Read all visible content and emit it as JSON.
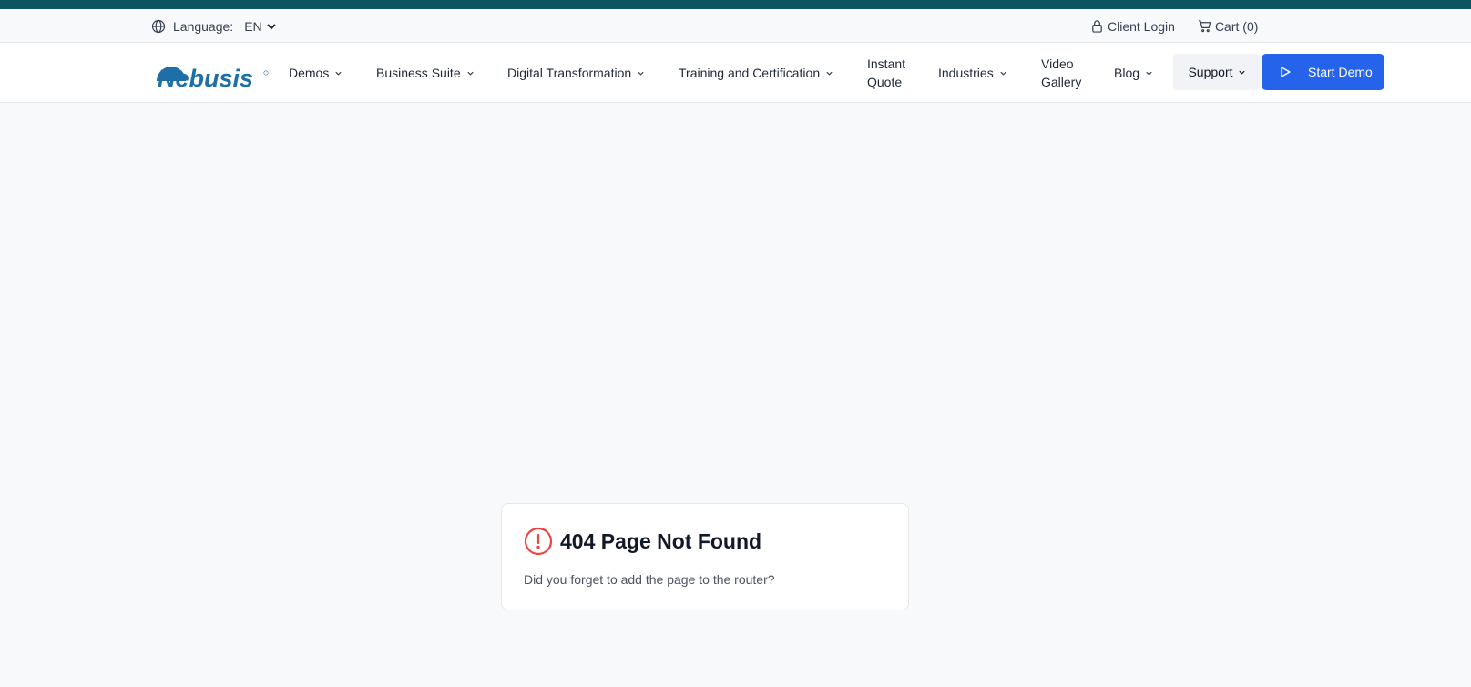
{
  "colors": {
    "top_stripe": "#0b5561",
    "brand_blue": "#1e6fa8",
    "primary_button": "#2563eb",
    "alert_red": "#ef4444"
  },
  "utility": {
    "language_label": "Language:",
    "language_value": "EN",
    "client_login": "Client Login",
    "cart": "Cart (0)"
  },
  "logo": {
    "text": "Nebusis"
  },
  "nav": {
    "demos": "Demos",
    "business_suite": "Business Suite",
    "digital_transformation": "Digital Transformation",
    "training_certification": "Training and Certification",
    "instant_quote_line1": "Instant",
    "instant_quote_line2": "Quote",
    "industries": "Industries",
    "video_gallery_line1": "Video",
    "video_gallery_line2": "Gallery",
    "blog": "Blog",
    "support": "Support",
    "start_demo": "Start Demo"
  },
  "error": {
    "title": "404 Page Not Found",
    "message": "Did you forget to add the page to the router?"
  }
}
